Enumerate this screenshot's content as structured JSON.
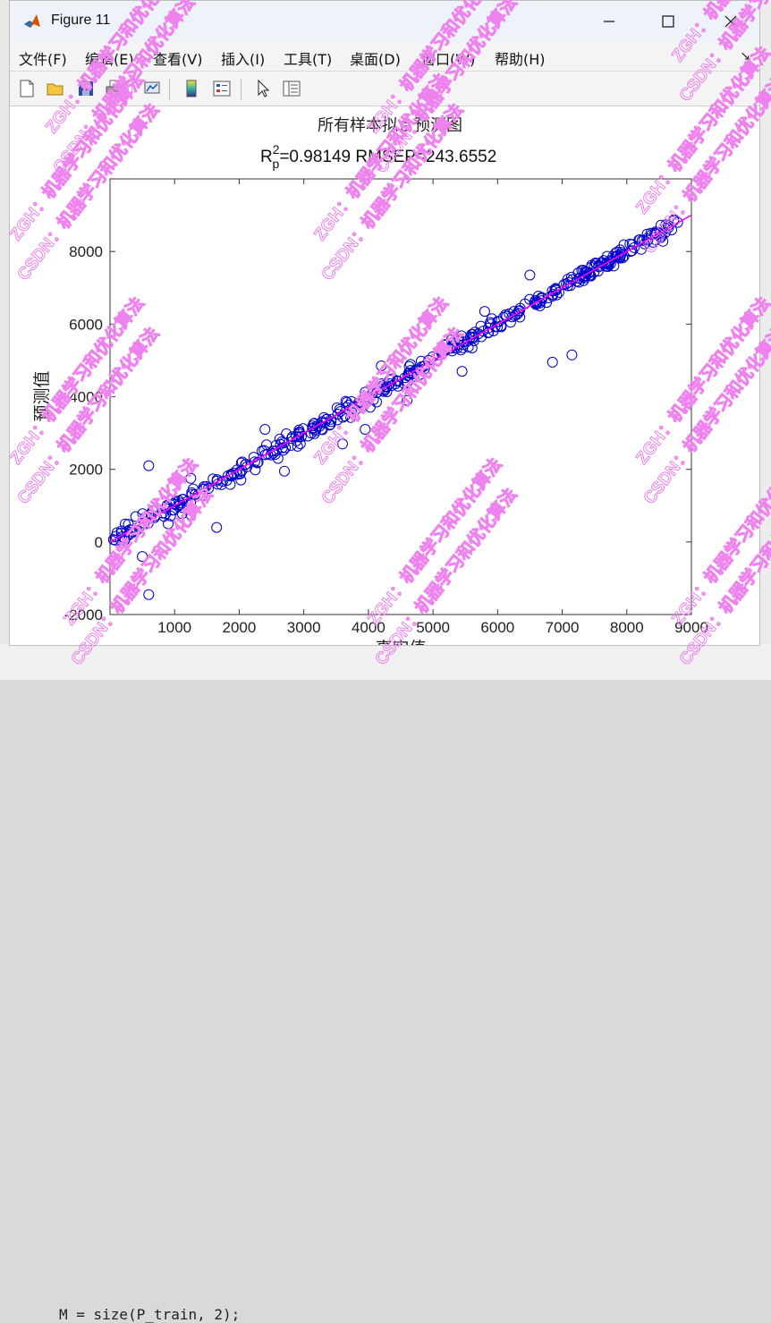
{
  "window": {
    "title": "Figure 11"
  },
  "menus": [
    "文件(F)",
    "编辑(E)",
    "查看(V)",
    "插入(I)",
    "工具(T)",
    "桌面(D)",
    "窗口(W)",
    "帮助(H)"
  ],
  "toolbar": [
    "new-figure-icon",
    "open-icon",
    "save-icon",
    "print-icon",
    "link-plot-icon",
    "insert-colorbar-icon",
    "insert-legend-icon",
    "pointer-icon",
    "property-inspector-icon"
  ],
  "background": {
    "code_line": "M = size(P_train, 2);"
  },
  "watermark": {
    "line1": "ZGH：机器学习和优化算法",
    "line2": "CSDN：机器学习和优化算法",
    "color": "#ee82ee"
  },
  "chart_data": {
    "type": "scatter",
    "title": "所有样本拟合预测图",
    "subtitle_parts": {
      "R": "R",
      "sup": "2",
      "sub": "p",
      "rest": "=0.98149  RMSEP=243.6552"
    },
    "xlabel": "真实值",
    "ylabel": "预测值",
    "xlim": [
      0,
      9000
    ],
    "ylim": [
      -2000,
      10000
    ],
    "xticks": [
      "1000",
      "2000",
      "3000",
      "4000",
      "5000",
      "6000",
      "7000",
      "8000",
      "9000"
    ],
    "yticks": [
      "-2000",
      "0",
      "2000",
      "4000",
      "6000",
      "8000"
    ],
    "marker_color": "#0000cc",
    "line_color": "#ff00ff",
    "fit_line": {
      "x": [
        0,
        9000
      ],
      "y": [
        0,
        9000
      ]
    },
    "outliers": {
      "x": [
        600,
        600,
        500,
        1650,
        1250,
        6850,
        7150,
        5450,
        3950,
        2400,
        2600,
        2700,
        3600,
        1250,
        6500,
        7800,
        4600,
        4200,
        5800,
        900
      ],
      "y": [
        2100,
        -1450,
        -400,
        400,
        750,
        4950,
        5150,
        4700,
        3100,
        3100,
        2300,
        1950,
        2700,
        1750,
        7350,
        7600,
        3900,
        4850,
        6350,
        500
      ]
    },
    "main_band": {
      "count": 420,
      "x_range": [
        50,
        8800
      ],
      "spread": 160
    }
  }
}
